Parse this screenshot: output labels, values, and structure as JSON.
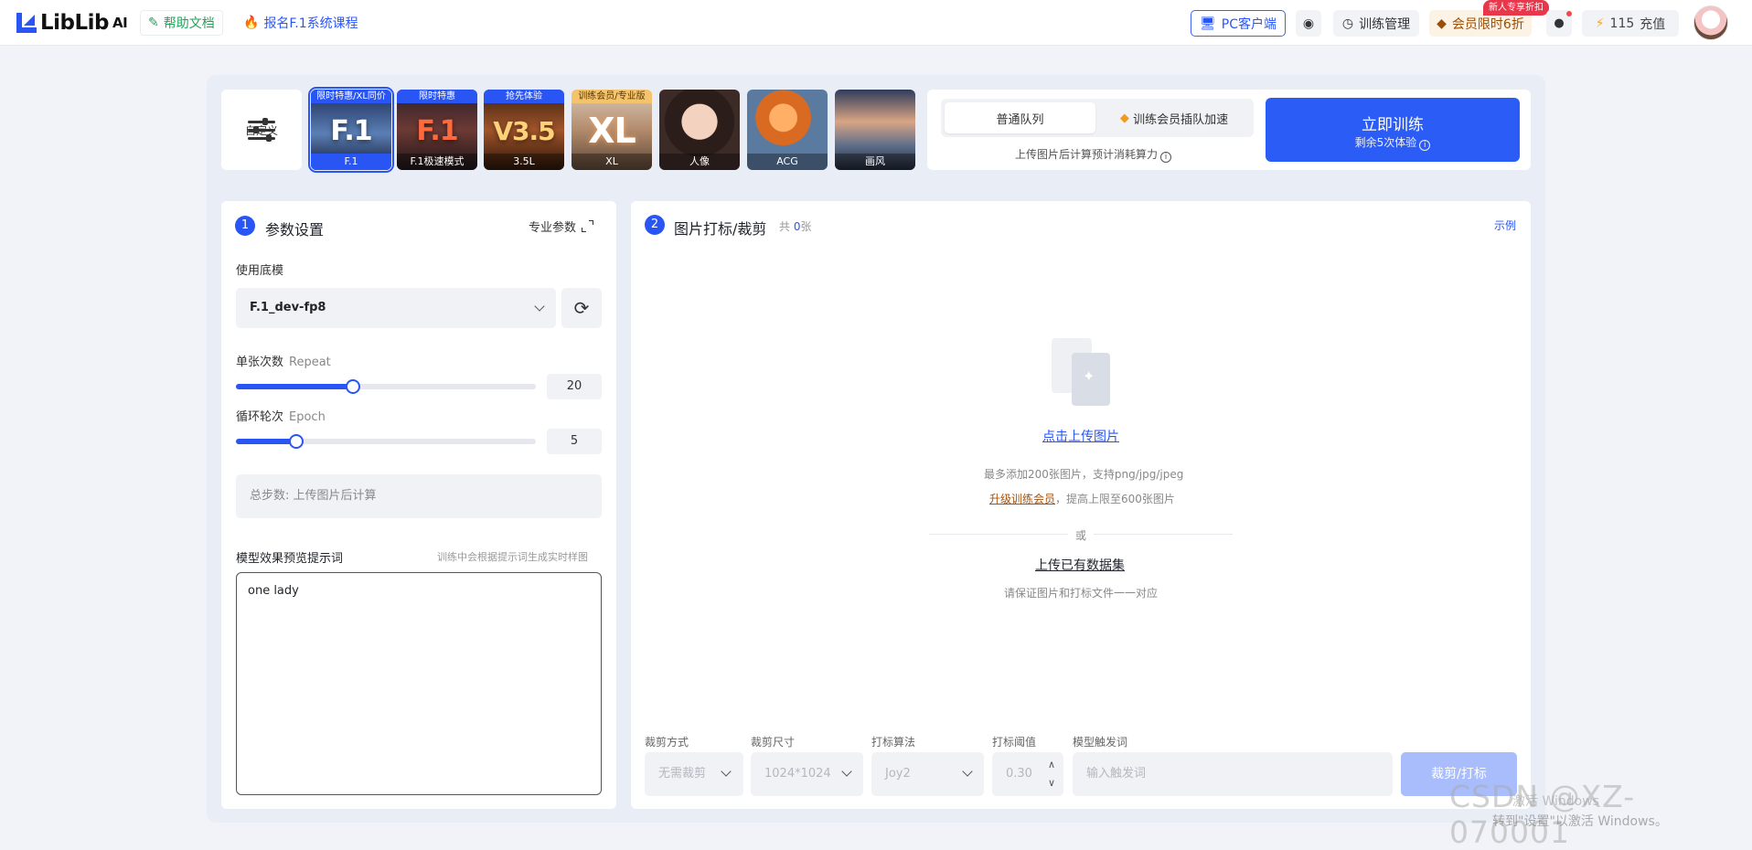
{
  "topbar": {
    "logo_text": "LibLib",
    "logo_ai": "AI",
    "help_docs": "帮助文档",
    "course_signup": "报名F.1系统课程",
    "pc_client": "PC客户端",
    "train_mgmt": "训练管理",
    "vip_offer": "会员限时6折",
    "vip_badge": "新人专享折扣",
    "credits": "115",
    "recharge": "充值"
  },
  "models": {
    "custom_label": "自定义",
    "tiles": [
      {
        "ribbon": "限时特惠/XL同价",
        "big": "F.1",
        "caption": "F.1",
        "selected": true
      },
      {
        "ribbon": "限时特惠",
        "big": "F.1",
        "caption": "F.1极速模式"
      },
      {
        "ribbon": "抢先体验",
        "big": "V3.5",
        "caption": "3.5L"
      },
      {
        "ribbon": "训练会员/专业版",
        "big": "XL",
        "caption": "XL"
      },
      {
        "ribbon": "",
        "big": "",
        "caption": "人像"
      },
      {
        "ribbon": "",
        "big": "",
        "caption": "ACG"
      },
      {
        "ribbon": "",
        "big": "",
        "caption": "画风"
      }
    ]
  },
  "queue": {
    "normal": "普通队列",
    "vip": "训练会员插队加速",
    "note": "上传图片后计算预计消耗算力",
    "train_button": "立即训练",
    "remaining": "剩余5次体验"
  },
  "params": {
    "step": "1",
    "title": "参数设置",
    "pro_params": "专业参数",
    "base_model_label": "使用底模",
    "base_model_value": "F.1_dev-fp8",
    "repeat_label": "单张次数",
    "repeat_en": "Repeat",
    "repeat_value": "20",
    "repeat_fraction": 0.39,
    "epoch_label": "循环轮次",
    "epoch_en": "Epoch",
    "epoch_value": "5",
    "epoch_fraction": 0.2,
    "total_steps": "总步数: 上传图片后计算",
    "prompt_title": "模型效果预览提示词",
    "prompt_hint": "训练中会根据提示词生成实时样图",
    "prompt_value": "one lady"
  },
  "images": {
    "step": "2",
    "title": "图片打标/裁剪",
    "count_prefix": "共",
    "count": "0",
    "count_suffix": "张",
    "example": "示例",
    "upload_link": "点击上传图片",
    "upload_note": "最多添加200张图片，支持png/jpg/jpeg",
    "upgrade_link": "升级训练会员",
    "upgrade_rest": "，提高上限至600张图片",
    "or": "或",
    "dataset_link": "上传已有数据集",
    "dataset_note": "请保证图片和打标文件一一对应",
    "crop_mode_label": "裁剪方式",
    "crop_mode_value": "无需裁剪",
    "crop_size_label": "裁剪尺寸",
    "crop_size_value": "1024*1024",
    "tag_algo_label": "打标算法",
    "tag_algo_value": "Joy2",
    "tag_threshold_label": "打标阈值",
    "tag_threshold_value": "0.30",
    "trigger_label": "模型触发词",
    "trigger_placeholder": "输入触发词",
    "crop_button": "裁剪/打标"
  },
  "overlay": {
    "watermark": "CSDN @XZ-070001",
    "win_title": "激活 Windows",
    "win_note": "转到\"设置\"以激活 Windows。"
  }
}
